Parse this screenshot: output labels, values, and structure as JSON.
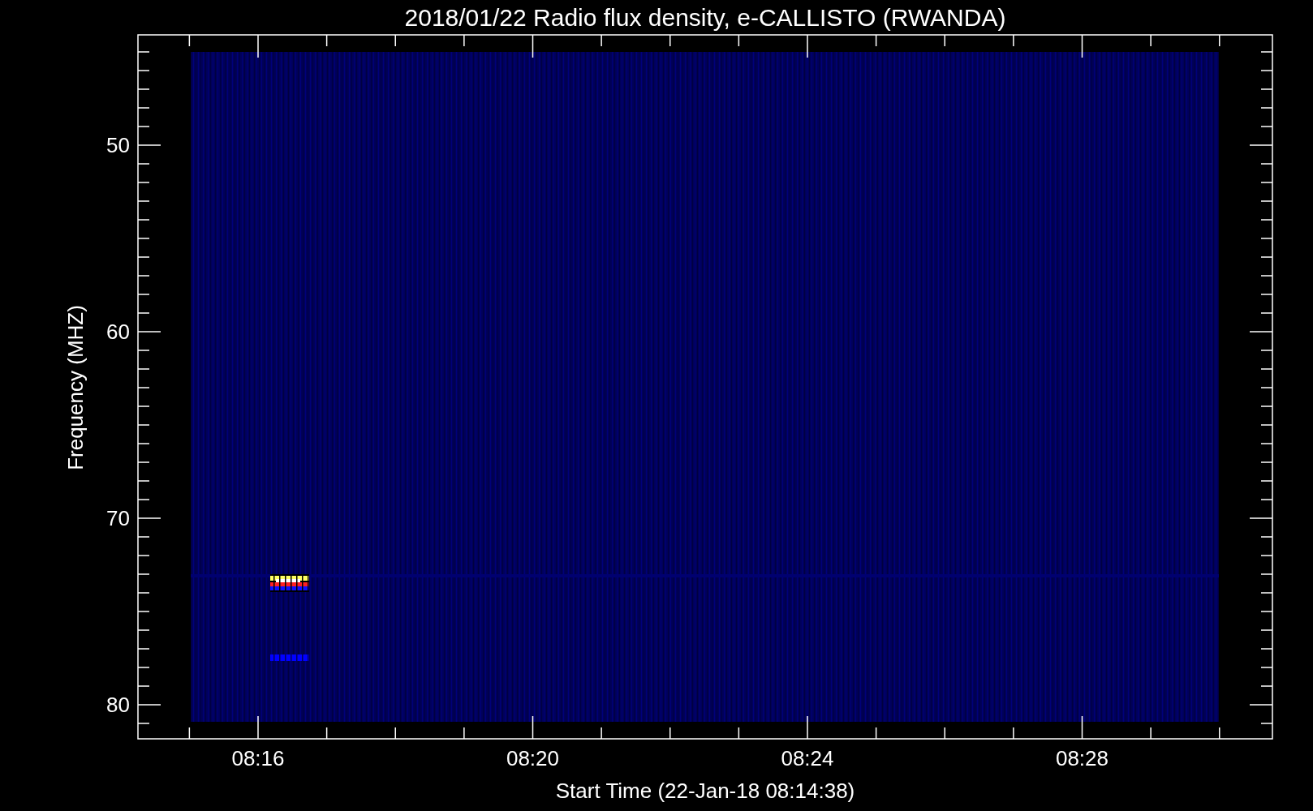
{
  "title": "2018/01/22  Radio flux density, e-CALLISTO (RWANDA)",
  "x_axis": {
    "label": "Start Time (22-Jan-18 08:14:38)",
    "ticks": [
      "08:16",
      "08:20",
      "08:24",
      "08:28"
    ]
  },
  "y_axis": {
    "label": "Frequency (MHZ)",
    "ticks": [
      "50",
      "60",
      "70",
      "80"
    ]
  }
}
